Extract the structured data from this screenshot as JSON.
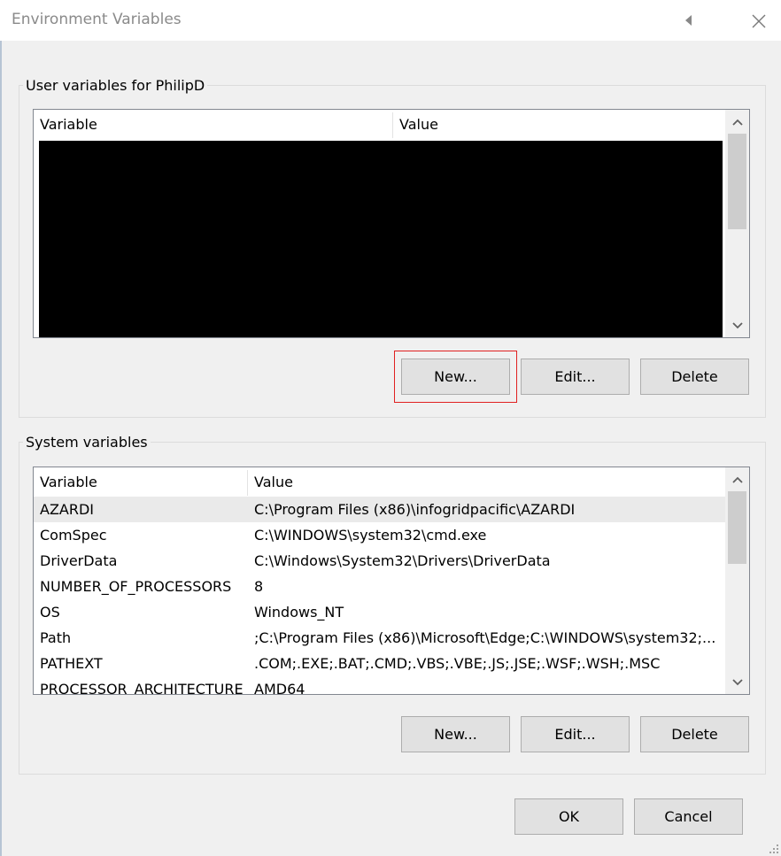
{
  "window": {
    "title": "Environment Variables"
  },
  "user_group": {
    "label": "User variables for PhilipD",
    "columns": [
      "Variable",
      "Value"
    ],
    "buttons": {
      "new": "New...",
      "edit": "Edit...",
      "delete": "Delete"
    }
  },
  "system_group": {
    "label": "System variables",
    "columns": [
      "Variable",
      "Value"
    ],
    "rows": [
      {
        "variable": "AZARDI",
        "value": "C:\\Program Files (x86)\\infogridpacific\\AZARDI"
      },
      {
        "variable": "ComSpec",
        "value": "C:\\WINDOWS\\system32\\cmd.exe"
      },
      {
        "variable": "DriverData",
        "value": "C:\\Windows\\System32\\Drivers\\DriverData"
      },
      {
        "variable": "NUMBER_OF_PROCESSORS",
        "value": "8"
      },
      {
        "variable": "OS",
        "value": "Windows_NT"
      },
      {
        "variable": "Path",
        "value": ";C:\\Program Files (x86)\\Microsoft\\Edge;C:\\WINDOWS\\system32;..."
      },
      {
        "variable": "PATHEXT",
        "value": ".COM;.EXE;.BAT;.CMD;.VBS;.VBE;.JS;.JSE;.WSF;.WSH;.MSC"
      },
      {
        "variable": "PROCESSOR_ARCHITECTURE",
        "value": "AMD64"
      }
    ],
    "buttons": {
      "new": "New...",
      "edit": "Edit...",
      "delete": "Delete"
    }
  },
  "footer": {
    "ok": "OK",
    "cancel": "Cancel"
  },
  "colors": {
    "highlight": "#e02020",
    "selected_row": "#eaeaea",
    "dialog_bg": "#f0f0f0",
    "button_bg": "#e1e1e1"
  }
}
